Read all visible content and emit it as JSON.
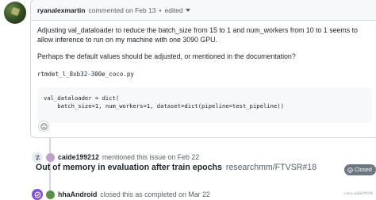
{
  "comment": {
    "author": "ryanalexmartin",
    "action": "commented on Feb 13",
    "separator": "•",
    "edited": "edited",
    "paragraph1": "Adjusting val_dataloader to reduce the batch_size from 15 to 1 and num_workers from 10 to 1 seems to allow inference to run on my machine with one 3090 GPU.",
    "paragraph2": "Perhaps the default values should be adjusted, or mentioned in the documentation?",
    "filename": "rtmdet_l_8xb32-300e_coco.py",
    "code": "val_dataloader = dict(\n    batch_size=1, num_workers=1, dataset=dict(pipeline=test_pipeline))"
  },
  "mention_event": {
    "user": "caide199212",
    "text": "mentioned this issue on Feb 22",
    "icon": "cross-reference-icon"
  },
  "referenced_issue": {
    "title": "Out of memory in evaluation after train epochs",
    "repo": "researchmm/FTVSR#18",
    "state": "Closed"
  },
  "close_event": {
    "user": "hhaAndroid",
    "text": "closed this as completed on Mar 22",
    "icon": "check-circle-icon"
  },
  "watermark": "CSDN @码码字节鸡",
  "colors": {
    "closed_badge": "#6e7781",
    "completed_icon": "#8250df",
    "border": "#d0d7de"
  }
}
